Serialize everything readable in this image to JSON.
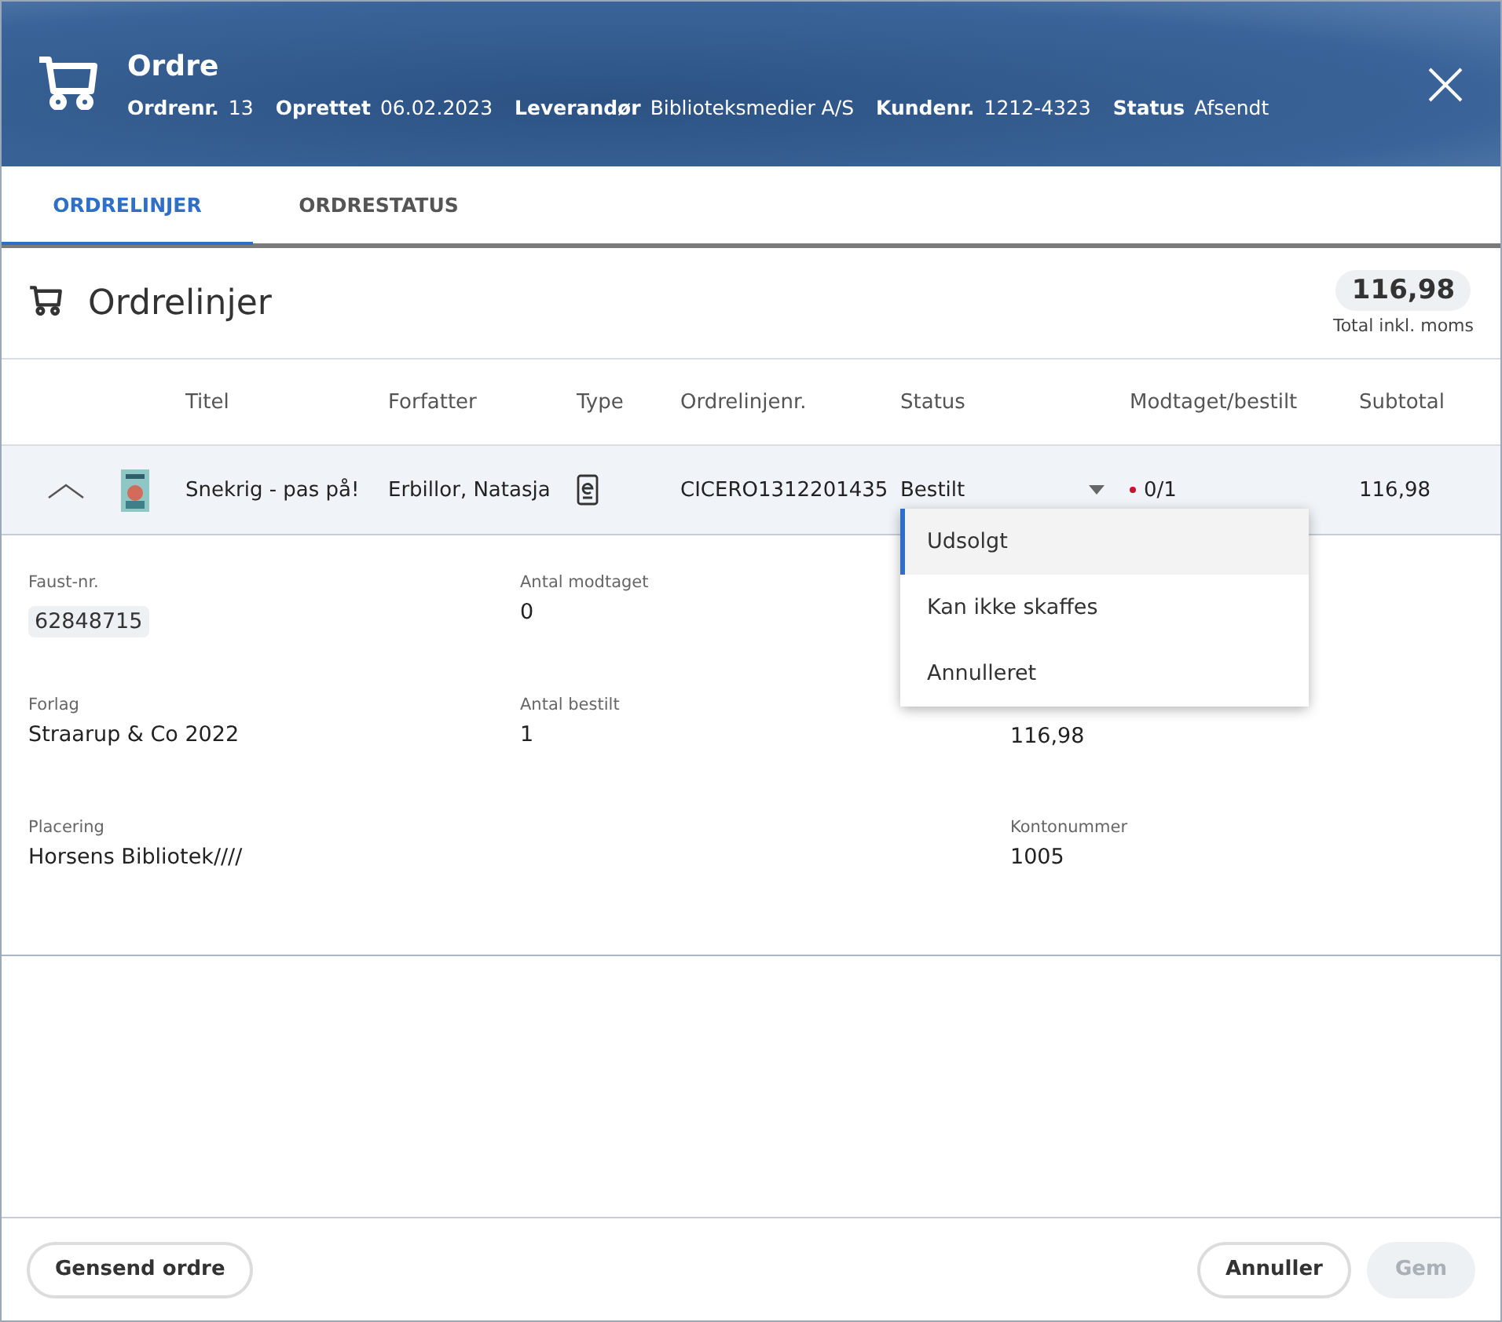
{
  "header": {
    "title": "Ordre",
    "meta": [
      {
        "label": "Ordrenr.",
        "value": "13"
      },
      {
        "label": "Oprettet",
        "value": "06.02.2023"
      },
      {
        "label": "Leverandør",
        "value": "Biblioteksmedier A/S"
      },
      {
        "label": "Kundenr.",
        "value": "1212-4323"
      },
      {
        "label": "Status",
        "value": "Afsendt"
      }
    ]
  },
  "tabs": [
    {
      "label": "ORDRELINJER",
      "selected": true
    },
    {
      "label": "ORDRESTATUS",
      "selected": false
    }
  ],
  "section": {
    "title": "Ordrelinjer",
    "total": "116,98",
    "total_label": "Total inkl. moms"
  },
  "table": {
    "columns": [
      "Titel",
      "Forfatter",
      "Type",
      "Ordrelinjenr.",
      "Status",
      "Modtaget/bestilt",
      "Subtotal"
    ],
    "rows": [
      {
        "expanded": true,
        "title": "Snekrig - pas på!",
        "author": "Erbillor, Natasja",
        "order_line": "CICERO1312201435",
        "status": "Bestilt",
        "received": "0/1",
        "subtotal": "116,98"
      }
    ]
  },
  "status_menu": [
    {
      "label": "Udsolgt",
      "highlighted": true
    },
    {
      "label": "Kan ikke skaffes",
      "highlighted": false
    },
    {
      "label": "Annulleret",
      "highlighted": false
    }
  ],
  "details": [
    {
      "label": "Faust-nr.",
      "value": "62848715",
      "kind": "chip"
    },
    {
      "label": "Antal modtaget",
      "value": "0",
      "kind": "text"
    },
    {
      "kind": "empty"
    },
    {
      "label": "Forlag",
      "value": "Straarup & Co 2022",
      "kind": "text"
    },
    {
      "label": "Antal bestilt",
      "value": "1",
      "kind": "text"
    },
    {
      "value": "116,98",
      "kind": "value_only"
    },
    {
      "label": "Placering",
      "value": "Horsens Bibliotek////",
      "kind": "text"
    },
    {
      "kind": "empty"
    },
    {
      "label": "Kontonummer",
      "value": "1005",
      "kind": "text"
    }
  ],
  "footer": {
    "left": [
      {
        "label": "Gensend ordre",
        "disabled": false
      }
    ],
    "right": [
      {
        "label": "Annuller",
        "disabled": false
      },
      {
        "label": "Gem",
        "disabled": true
      }
    ]
  }
}
